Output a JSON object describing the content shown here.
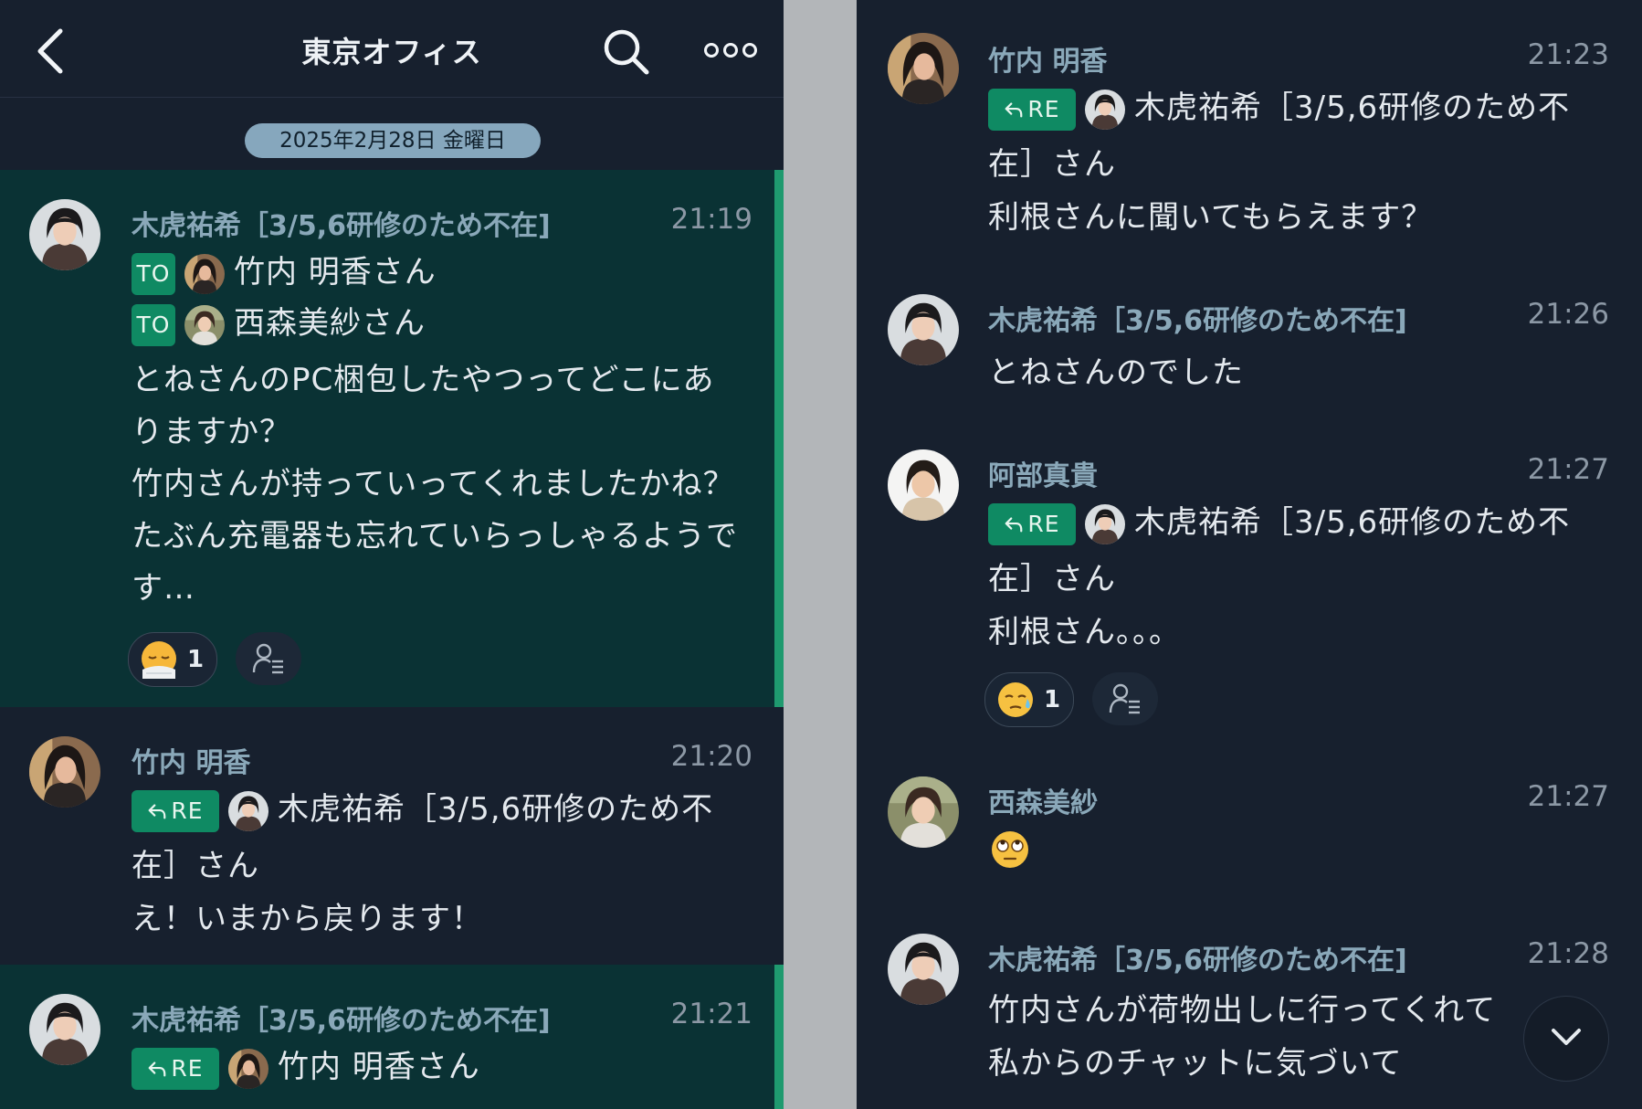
{
  "header": {
    "title": "東京オフィス"
  },
  "date_label": "2025年2月28日 金曜日",
  "tags": {
    "to": "TO",
    "re": "RE"
  },
  "left_messages": [
    {
      "sender": "木虎祐希［3/5,6研修のため不在]",
      "time": "21:19",
      "to_1": "竹内 明香さん",
      "to_2": "西森美紗さん",
      "lines": [
        "とねさんのPC梱包したやつってどこにあ",
        "りますか？",
        "竹内さんが持っていってくれましたかね？",
        "たぶん充電器も忘れていらっしゃるようで",
        "す…"
      ],
      "reaction_count": "1"
    },
    {
      "sender": "竹内 明香",
      "time": "21:20",
      "re_target": "木虎祐希［3/5,6研修のため不",
      "lines": [
        "在］さん",
        "え！いまから戻ります！"
      ]
    },
    {
      "sender": "木虎祐希［3/5,6研修のため不在]",
      "time": "21:21",
      "re_target": "竹内 明香さん"
    }
  ],
  "right_messages": [
    {
      "sender": "竹内 明香",
      "time": "21:23",
      "re_target": "木虎祐希［3/5,6研修のため不",
      "lines": [
        "在］さん",
        "利根さんに聞いてもらえます？"
      ]
    },
    {
      "sender": "木虎祐希［3/5,6研修のため不在]",
      "time": "21:26",
      "lines": [
        "とねさんのでした"
      ]
    },
    {
      "sender": "阿部真貴",
      "time": "21:27",
      "re_target": "木虎祐希［3/5,6研修のため不",
      "lines": [
        "在］さん",
        "利根さん。。。"
      ],
      "reaction_count": "1"
    },
    {
      "sender": "西森美紗",
      "time": "21:27"
    },
    {
      "sender": "木虎祐希［3/5,6研修のため不在]",
      "time": "21:28",
      "lines": [
        "竹内さんが荷物出しに行ってくれて",
        "私からのチャットに気づいて"
      ]
    }
  ],
  "colors": {
    "background": "#17202e",
    "highlight": "#0a3234",
    "accent": "#0f8a63",
    "sender": "#8aa8b9",
    "date_pill": "#86a7bd"
  },
  "icons": [
    "back-chevron-icon",
    "search-icon",
    "more-dots-icon",
    "read-members-icon",
    "scroll-down-chevron-icon",
    "sleepy-emoji-icon",
    "sweat-emoji-icon",
    "eye-roll-emoji-icon",
    "reply-arrow-icon"
  ]
}
